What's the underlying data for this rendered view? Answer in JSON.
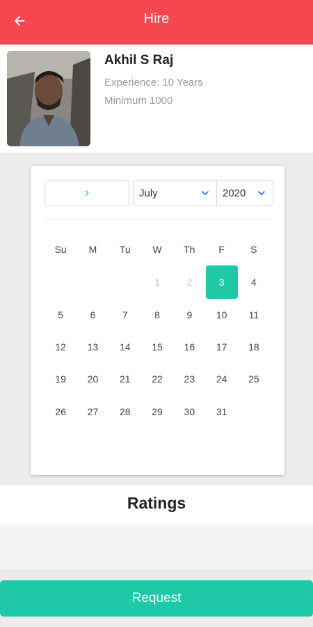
{
  "appbar": {
    "title": "Hire",
    "color": "#f5474f"
  },
  "profile": {
    "name": "Akhil S Raj",
    "experience": "Experience: 10 Years",
    "minimum": "Minimum 1000"
  },
  "calendar": {
    "month": "July",
    "year": "2020",
    "weekdays": [
      "Su",
      "M",
      "Tu",
      "W",
      "Th",
      "F",
      "S"
    ],
    "leading_blanks": 3,
    "days": [
      {
        "d": "1",
        "state": "disabled"
      },
      {
        "d": "2",
        "state": "disabled"
      },
      {
        "d": "3",
        "state": "selected"
      },
      {
        "d": "4",
        "state": ""
      },
      {
        "d": "5",
        "state": ""
      },
      {
        "d": "6",
        "state": ""
      },
      {
        "d": "7",
        "state": ""
      },
      {
        "d": "8",
        "state": ""
      },
      {
        "d": "9",
        "state": ""
      },
      {
        "d": "10",
        "state": ""
      },
      {
        "d": "11",
        "state": ""
      },
      {
        "d": "12",
        "state": ""
      },
      {
        "d": "13",
        "state": ""
      },
      {
        "d": "14",
        "state": ""
      },
      {
        "d": "15",
        "state": ""
      },
      {
        "d": "16",
        "state": ""
      },
      {
        "d": "17",
        "state": ""
      },
      {
        "d": "18",
        "state": ""
      },
      {
        "d": "19",
        "state": ""
      },
      {
        "d": "20",
        "state": ""
      },
      {
        "d": "21",
        "state": ""
      },
      {
        "d": "22",
        "state": ""
      },
      {
        "d": "23",
        "state": ""
      },
      {
        "d": "24",
        "state": ""
      },
      {
        "d": "25",
        "state": ""
      },
      {
        "d": "26",
        "state": ""
      },
      {
        "d": "27",
        "state": ""
      },
      {
        "d": "28",
        "state": ""
      },
      {
        "d": "29",
        "state": ""
      },
      {
        "d": "30",
        "state": ""
      },
      {
        "d": "31",
        "state": ""
      }
    ],
    "accent": "#1fc8a6"
  },
  "ratings": {
    "title": "Ratings"
  },
  "request": {
    "label": "Request",
    "color": "#1fc8a6"
  },
  "icons": {
    "back": "arrow-left-icon",
    "next": "chevron-right-icon",
    "dropdown": "chevron-down-icon"
  }
}
